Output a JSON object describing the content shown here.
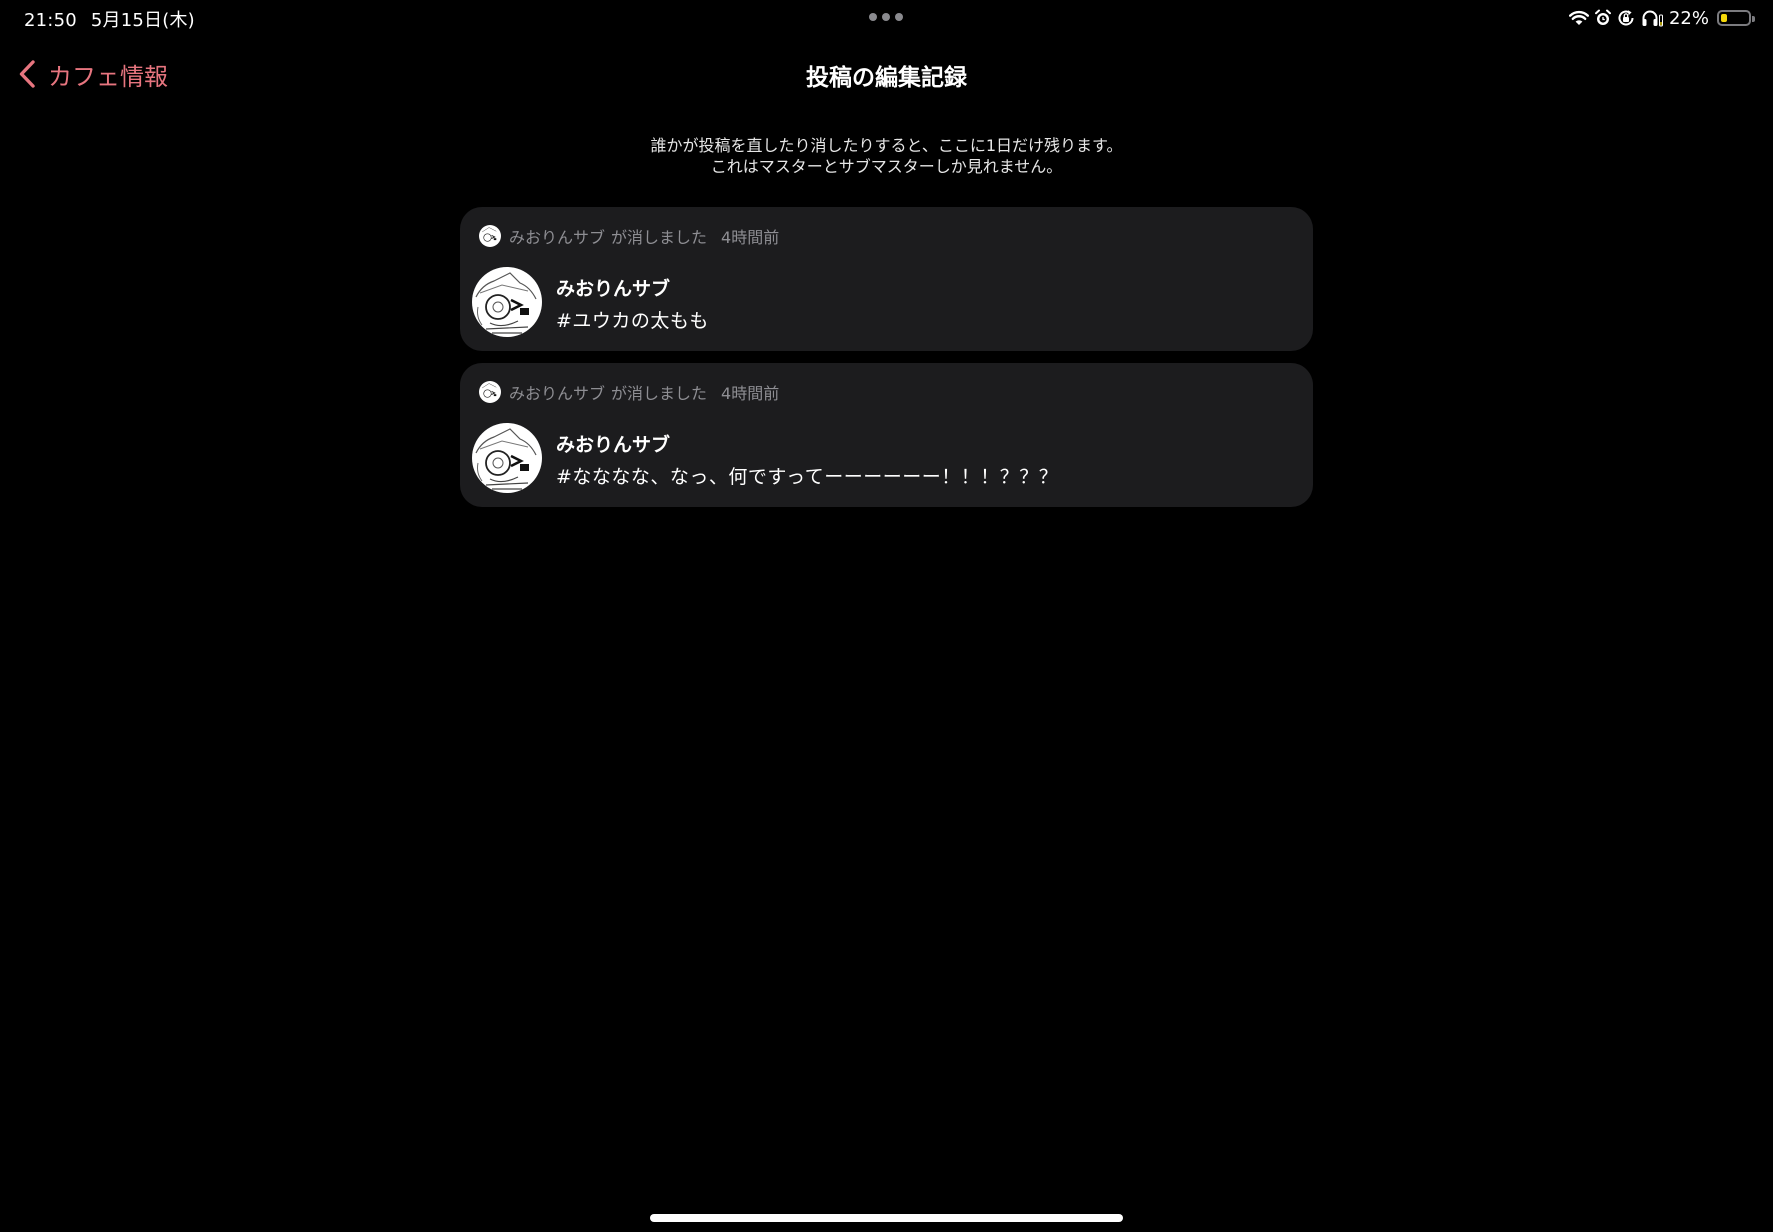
{
  "status_bar": {
    "time": "21:50",
    "date": "5月15日(木)",
    "battery_percent_text": "22%",
    "battery_level": 0.22,
    "battery_color": "#f5d90a",
    "icons": [
      "wifi-icon",
      "alarm-icon",
      "orientation-lock-icon",
      "headphones-icon",
      "battery-icon"
    ]
  },
  "nav": {
    "back_label": "カフェ情報",
    "back_icon": "chevron-left-icon",
    "title": "投稿の編集記録",
    "accent_color": "#e7757f"
  },
  "description": {
    "line1": "誰かが投稿を直したり消したりすると、ここに1日だけ残ります。",
    "line2": "これはマスターとサブマスターしか見れません。"
  },
  "logs": [
    {
      "actor": "みおりんサブ",
      "action": "が消しました",
      "time_ago": "4時間前",
      "author": "みおりんサブ",
      "text": "#ユウカの太もも"
    },
    {
      "actor": "みおりんサブ",
      "action": "が消しました",
      "time_ago": "4時間前",
      "author": "みおりんサブ",
      "text": "#なななな、なっ、何ですってーーーーーー！！！？？？"
    }
  ]
}
